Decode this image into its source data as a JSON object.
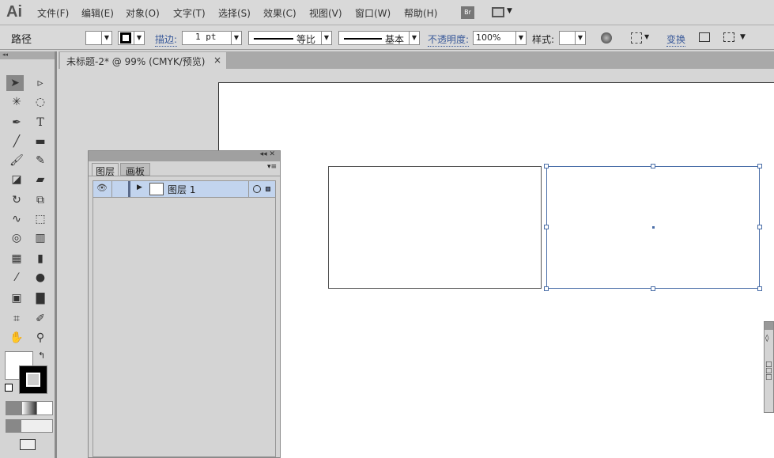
{
  "app": {
    "logo": "Ai"
  },
  "menu": [
    "文件(F)",
    "编辑(E)",
    "对象(O)",
    "文字(T)",
    "选择(S)",
    "效果(C)",
    "视图(V)",
    "窗口(W)",
    "帮助(H)"
  ],
  "bridge": "Br",
  "control": {
    "object_type": "路径",
    "stroke_label": "描边:",
    "stroke_weight": "1 pt",
    "profile": "等比",
    "brush": "基本",
    "opacity_label": "不透明度:",
    "opacity": "100%",
    "style_label": "样式:",
    "transform_label": "变换"
  },
  "document": {
    "tab_title": "未标题-2* @ 99% (CMYK/预览)",
    "close": "×"
  },
  "layers_panel": {
    "tabs": [
      "图层",
      "画板"
    ],
    "layers": [
      {
        "name": "图层 1"
      }
    ]
  }
}
